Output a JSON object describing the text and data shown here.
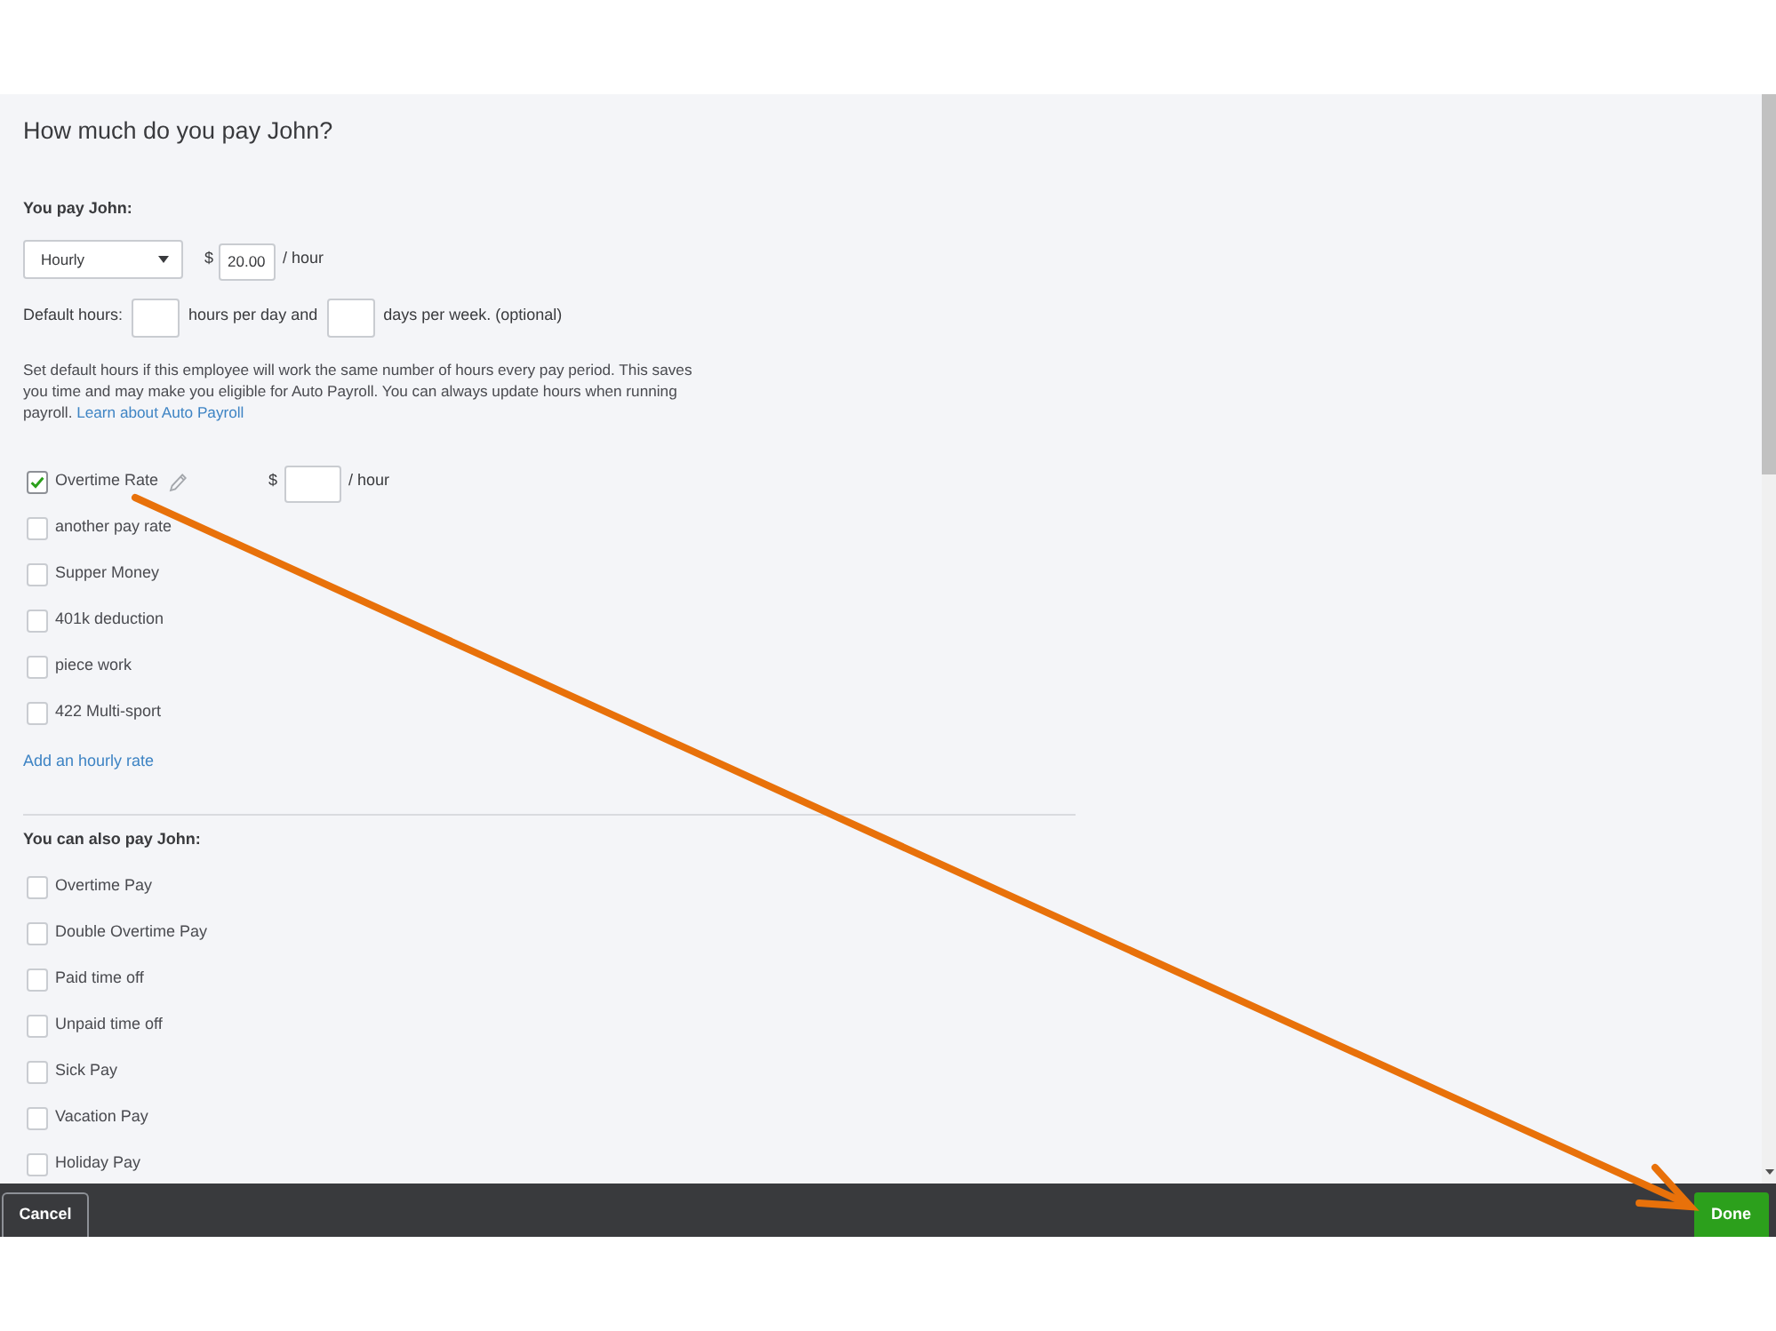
{
  "dialog": {
    "title": "How much do you pay John?"
  },
  "pay": {
    "heading": "You pay John:",
    "pay_type": "Hourly",
    "currency": "$",
    "rate": "20.00",
    "unit": "/ hour"
  },
  "default_hours": {
    "label": "Default hours:",
    "middle": "hours per day and",
    "suffix": "days per week. (optional)"
  },
  "note": {
    "text": "Set default hours if this employee will work the same number of hours every pay period. This saves you time and may make you eligible for Auto Payroll. You can always update hours when running payroll.",
    "link": "Learn about Auto Payroll"
  },
  "pay_rates": [
    {
      "kind": "editable",
      "label": "Overtime Rate",
      "checked": true,
      "currency": "$",
      "unit": "/ hour"
    },
    {
      "kind": "plain",
      "label": "another pay rate",
      "checked": false
    },
    {
      "kind": "plain",
      "label": "Supper Money",
      "checked": false
    },
    {
      "kind": "plain",
      "label": "401k deduction",
      "checked": false
    },
    {
      "kind": "plain",
      "label": "piece work",
      "checked": false
    },
    {
      "kind": "plain",
      "label": "422 Multi-sport",
      "checked": false
    }
  ],
  "add_rate_link": "Add an hourly rate",
  "extra_pay": {
    "heading": "You can also pay John:",
    "items": [
      {
        "label": "Overtime Pay",
        "checked": false
      },
      {
        "label": "Double Overtime Pay",
        "checked": false
      },
      {
        "label": "Paid time off",
        "checked": false
      },
      {
        "label": "Unpaid time off",
        "checked": false
      },
      {
        "label": "Sick Pay",
        "checked": false
      },
      {
        "label": "Vacation Pay",
        "checked": false
      },
      {
        "label": "Holiday Pay",
        "checked": false
      }
    ]
  },
  "footer": {
    "buttons": [
      {
        "kind": "secondary",
        "label": "Cancel"
      },
      {
        "kind": "primary",
        "label": "Done"
      }
    ]
  }
}
